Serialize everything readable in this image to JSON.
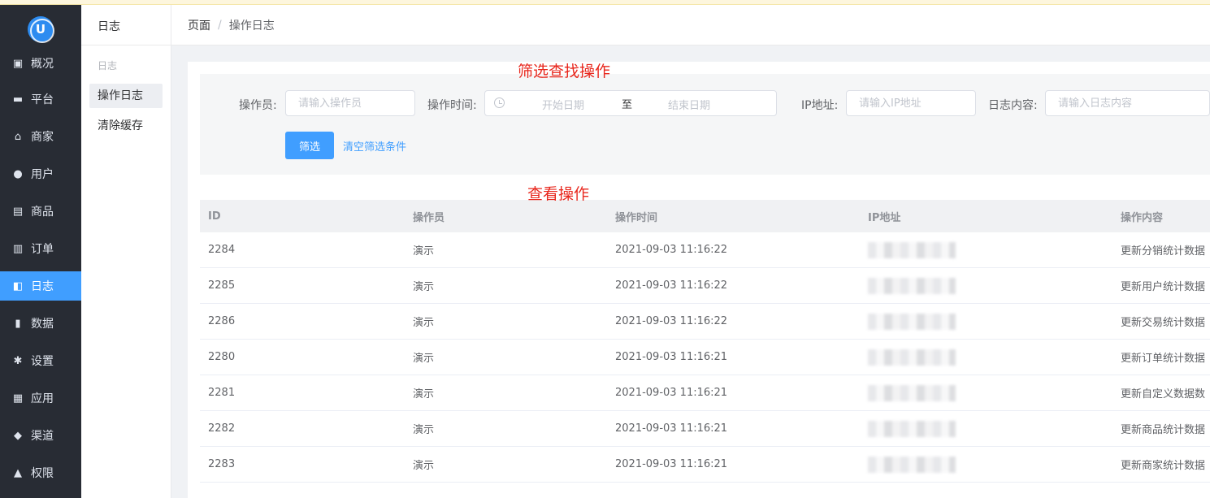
{
  "sidebar": {
    "logo_text": "U",
    "items": [
      {
        "label": "概况",
        "icon": "dashboard-icon",
        "glyph": "▣"
      },
      {
        "label": "平台",
        "icon": "monitor-icon",
        "glyph": "▬"
      },
      {
        "label": "商家",
        "icon": "store-icon",
        "glyph": "⌂"
      },
      {
        "label": "用户",
        "icon": "user-icon",
        "glyph": "●"
      },
      {
        "label": "商品",
        "icon": "goods-icon",
        "glyph": "▤"
      },
      {
        "label": "订单",
        "icon": "order-icon",
        "glyph": "▥"
      },
      {
        "label": "日志",
        "icon": "log-icon",
        "glyph": "◧"
      },
      {
        "label": "数据",
        "icon": "chart-icon",
        "glyph": "▮"
      },
      {
        "label": "设置",
        "icon": "gear-icon",
        "glyph": "✱"
      },
      {
        "label": "应用",
        "icon": "apps-icon",
        "glyph": "▦"
      },
      {
        "label": "渠道",
        "icon": "cube-icon",
        "glyph": "◆"
      },
      {
        "label": "权限",
        "icon": "lock-icon",
        "glyph": "▲"
      }
    ],
    "active_index": 6
  },
  "submenu": {
    "title": "日志",
    "group_label": "日志",
    "items": [
      "操作日志",
      "清除缓存"
    ]
  },
  "breadcrumb": {
    "root": "页面",
    "separator": "/",
    "current": "操作日志"
  },
  "filters": {
    "operator_label": "操作员:",
    "operator_placeholder": "请输入操作员",
    "time_label": "操作时间:",
    "start_placeholder": "开始日期",
    "range_separator": "至",
    "end_placeholder": "结束日期",
    "ip_label": "IP地址:",
    "ip_placeholder": "请输入IP地址",
    "content_label": "日志内容:",
    "content_placeholder": "请输入日志内容",
    "filter_button": "筛选",
    "clear_link": "清空筛选条件"
  },
  "annotations": {
    "filter_note": "筛选查找操作",
    "view_note": "查看操作"
  },
  "table": {
    "headers": [
      "ID",
      "操作员",
      "操作时间",
      "IP地址",
      "操作内容"
    ],
    "rows": [
      {
        "id": "2284",
        "operator": "演示",
        "time": "2021-09-03 11:16:22",
        "content": "更新分销统计数据"
      },
      {
        "id": "2285",
        "operator": "演示",
        "time": "2021-09-03 11:16:22",
        "content": "更新用户统计数据"
      },
      {
        "id": "2286",
        "operator": "演示",
        "time": "2021-09-03 11:16:22",
        "content": "更新交易统计数据"
      },
      {
        "id": "2280",
        "operator": "演示",
        "time": "2021-09-03 11:16:21",
        "content": "更新订单统计数据"
      },
      {
        "id": "2281",
        "operator": "演示",
        "time": "2021-09-03 11:16:21",
        "content": "更新自定义数据数"
      },
      {
        "id": "2282",
        "operator": "演示",
        "time": "2021-09-03 11:16:21",
        "content": "更新商品统计数据"
      },
      {
        "id": "2283",
        "operator": "演示",
        "time": "2021-09-03 11:16:21",
        "content": "更新商家统计数据"
      }
    ]
  },
  "colors": {
    "sidebar_bg": "#282c34",
    "accent": "#409eff",
    "annotation": "#e8271d"
  }
}
